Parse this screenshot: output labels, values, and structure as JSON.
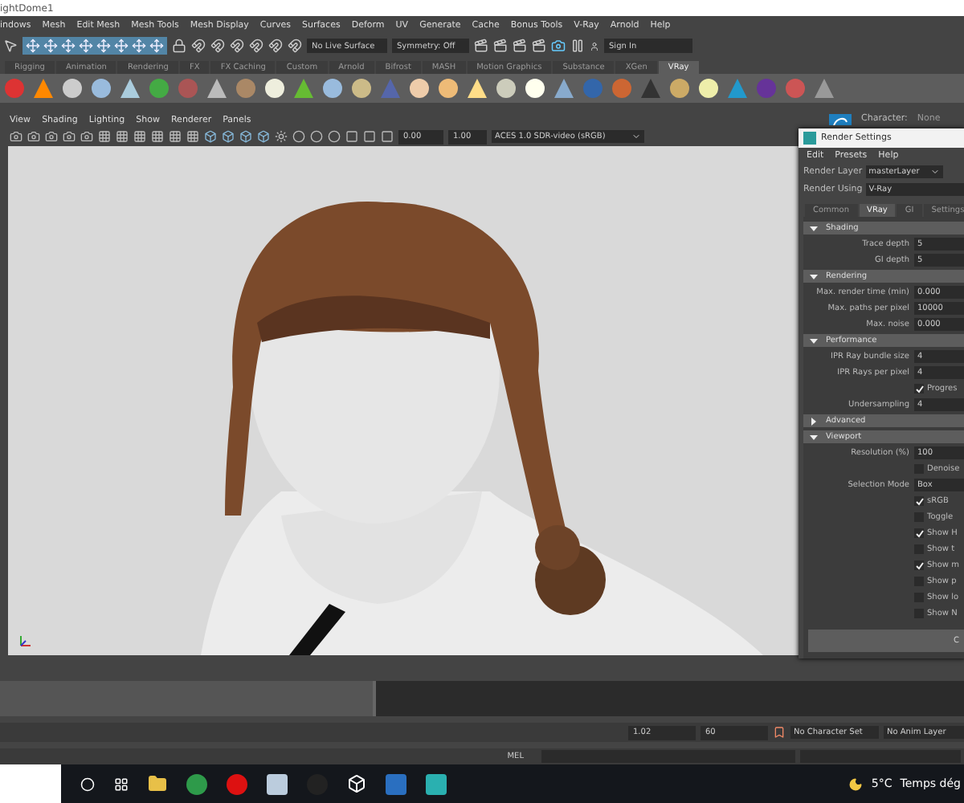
{
  "window": {
    "title": "ightDome1"
  },
  "menu_bar": [
    "indows",
    "Mesh",
    "Edit Mesh",
    "Mesh Tools",
    "Mesh Display",
    "Curves",
    "Surfaces",
    "Deform",
    "UV",
    "Generate",
    "Cache",
    "Bonus Tools",
    "V-Ray",
    "Arnold",
    "Help"
  ],
  "status_line": {
    "live_surface": "No Live Surface",
    "symmetry": "Symmetry: Off",
    "sign_in": "Sign In"
  },
  "shelf_tabs": [
    {
      "label": "Rigging",
      "selected": false
    },
    {
      "label": "Animation",
      "selected": false
    },
    {
      "label": "Rendering",
      "selected": false
    },
    {
      "label": "FX",
      "selected": false
    },
    {
      "label": "FX Caching",
      "selected": false
    },
    {
      "label": "Custom",
      "selected": false
    },
    {
      "label": "Arnold",
      "selected": false
    },
    {
      "label": "Bifrost",
      "selected": false
    },
    {
      "label": "MASH",
      "selected": false
    },
    {
      "label": "Motion Graphics",
      "selected": false
    },
    {
      "label": "Substance",
      "selected": false
    },
    {
      "label": "XGen",
      "selected": false
    },
    {
      "label": "VRay",
      "selected": true
    }
  ],
  "viewport": {
    "menu": [
      "View",
      "Shading",
      "Lighting",
      "Show",
      "Renderer",
      "Panels"
    ],
    "exposure": "0.00",
    "gamma": "1.00",
    "color_space": "ACES 1.0 SDR-video (sRGB)"
  },
  "side_panel": {
    "character_label": "Character:",
    "character_value": "None"
  },
  "render_settings": {
    "title": "Render Settings",
    "menu": [
      "Edit",
      "Presets",
      "Help"
    ],
    "render_layer_label": "Render Layer",
    "render_layer": "masterLayer",
    "render_using_label": "Render Using",
    "render_using": "V-Ray",
    "tabs": [
      {
        "label": "Common",
        "selected": false
      },
      {
        "label": "VRay",
        "selected": true
      },
      {
        "label": "GI",
        "selected": false
      },
      {
        "label": "Settings",
        "selected": false
      }
    ],
    "sections": [
      {
        "title": "Shading",
        "expanded": true,
        "rows": [
          {
            "kind": "field",
            "label": "Trace depth",
            "value": "5"
          },
          {
            "kind": "field",
            "label": "GI depth",
            "value": "5"
          }
        ]
      },
      {
        "title": "Rendering",
        "expanded": true,
        "rows": [
          {
            "kind": "field",
            "label": "Max. render time (min)",
            "value": "0.000"
          },
          {
            "kind": "field",
            "label": "Max. paths per pixel",
            "value": "10000"
          },
          {
            "kind": "field",
            "label": "Max. noise",
            "value": "0.000"
          }
        ]
      },
      {
        "title": "Performance",
        "expanded": true,
        "rows": [
          {
            "kind": "field",
            "label": "IPR Ray bundle size",
            "value": "4"
          },
          {
            "kind": "field",
            "label": "IPR Rays per pixel",
            "value": "4"
          },
          {
            "kind": "check",
            "label": "Progres",
            "checked": true
          },
          {
            "kind": "field",
            "label": "Undersampling",
            "value": "4"
          }
        ]
      },
      {
        "title": "Advanced",
        "expanded": false
      },
      {
        "title": "Viewport",
        "expanded": true,
        "rows": [
          {
            "kind": "field",
            "label": "Resolution (%)",
            "value": "100"
          },
          {
            "kind": "check",
            "label": "Denoise",
            "checked": false
          },
          {
            "kind": "dropdown",
            "label": "Selection Mode",
            "value": "Box"
          },
          {
            "kind": "check",
            "label": "sRGB",
            "checked": true
          },
          {
            "kind": "check",
            "label": "Toggle",
            "checked": false
          },
          {
            "kind": "check",
            "label": "Show H",
            "checked": true
          },
          {
            "kind": "check",
            "label": "Show t",
            "checked": false
          },
          {
            "kind": "check",
            "label": "Show m",
            "checked": true
          },
          {
            "kind": "check",
            "label": "Show p",
            "checked": false
          },
          {
            "kind": "check",
            "label": "Show lo",
            "checked": false
          },
          {
            "kind": "check",
            "label": "Show N",
            "checked": false
          }
        ]
      }
    ],
    "bottom_button": "C"
  },
  "range_bar": {
    "current": "1.02",
    "end": "60",
    "character_set": "No Character Set",
    "anim_layer": "No Anim Layer"
  },
  "command_line": {
    "language": "MEL"
  },
  "taskbar": {
    "temperature": "5°C",
    "weather": "Temps dég"
  }
}
